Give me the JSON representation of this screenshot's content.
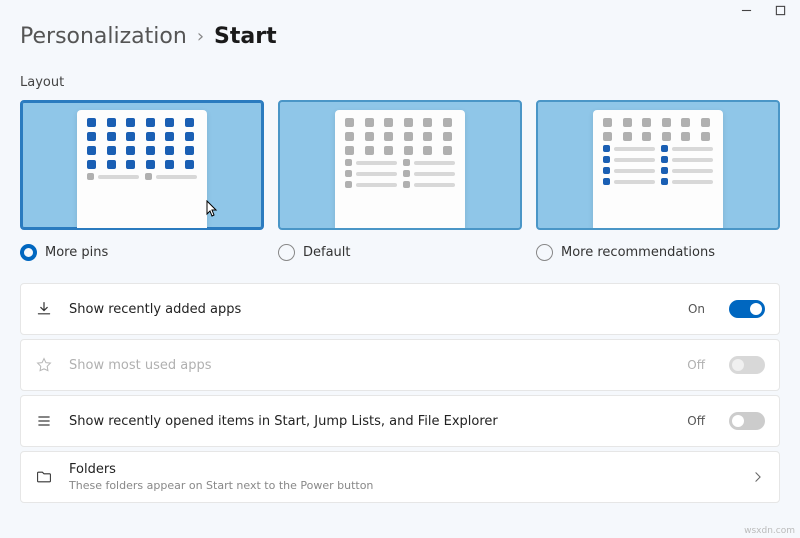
{
  "window": {
    "min_tip": "Minimize",
    "max_tip": "Maximize"
  },
  "breadcrumbs": {
    "parent": "Personalization",
    "sep": "›",
    "current": "Start"
  },
  "layout": {
    "label": "Layout",
    "options": [
      {
        "label": "More pins",
        "selected": true
      },
      {
        "label": "Default",
        "selected": false
      },
      {
        "label": "More recommendations",
        "selected": false
      }
    ]
  },
  "settings": {
    "recent_apps": {
      "label": "Show recently added apps",
      "state": "On",
      "on": true,
      "enabled": true
    },
    "most_used": {
      "label": "Show most used apps",
      "state": "Off",
      "on": false,
      "enabled": false
    },
    "recent_items": {
      "label": "Show recently opened items in Start, Jump Lists, and File Explorer",
      "state": "Off",
      "on": false,
      "enabled": true
    },
    "folders": {
      "title": "Folders",
      "desc": "These folders appear on Start next to the Power button"
    }
  },
  "footer": "wsxdn.com"
}
